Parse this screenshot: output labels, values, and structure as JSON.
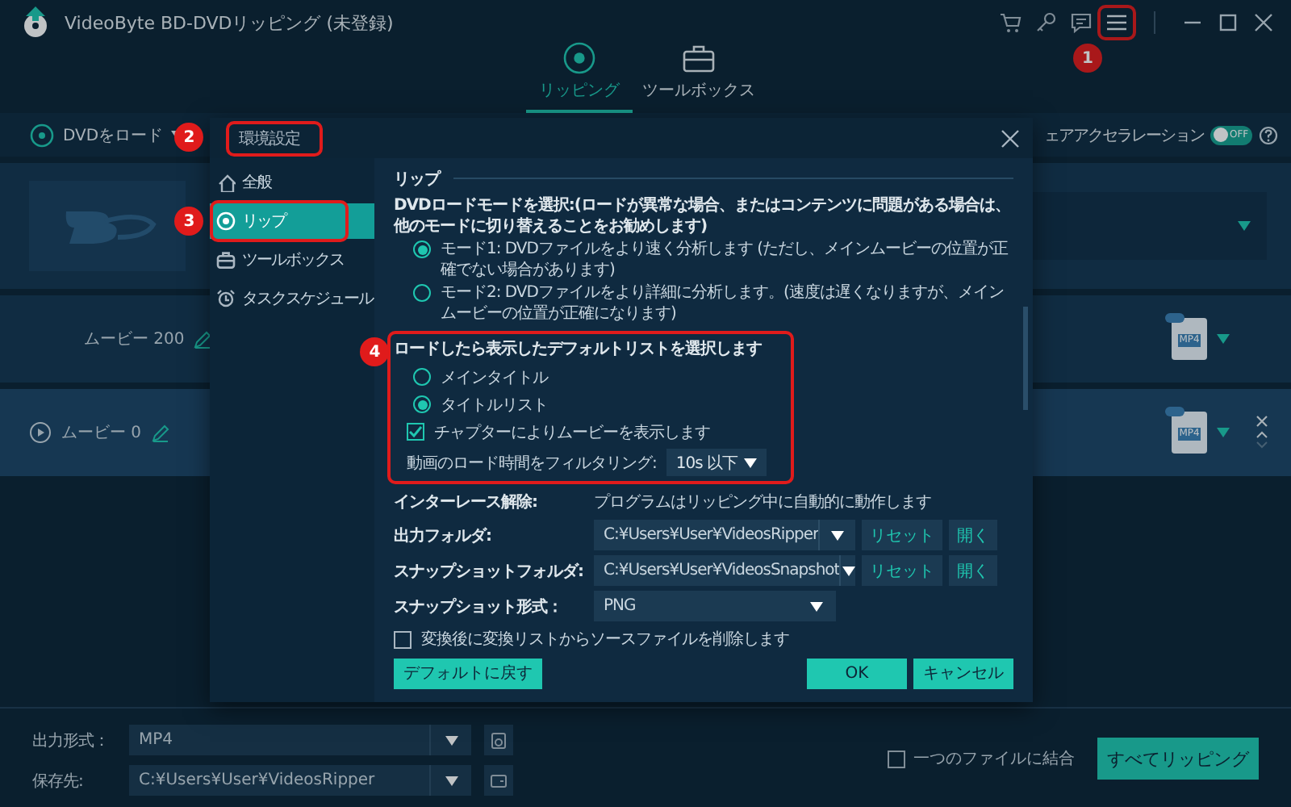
{
  "window": {
    "title": "VideoByte BD-DVDリッピング (未登録)"
  },
  "tabs": [
    {
      "label": "リッピング",
      "selected": true,
      "kind": "disc"
    },
    {
      "label": "ツールボックス",
      "selected": false,
      "kind": "toolbox"
    }
  ],
  "toolbar": {
    "load_button": "DVDをロード",
    "hardware_acceleration": {
      "label": "ェアアクセラレーション",
      "on": false,
      "switch_text": "OFF"
    }
  },
  "movies": [
    {
      "title": "ムービー 200",
      "format": "MP4",
      "selected": false
    },
    {
      "title": "ムービー 0",
      "format": "MP4",
      "selected": true
    }
  ],
  "dialog": {
    "title": "環境設定",
    "nav": [
      {
        "label": "全般",
        "selected": false,
        "kind": "home"
      },
      {
        "label": "リップ",
        "selected": true,
        "kind": "disc"
      },
      {
        "label": "ツールボックス",
        "selected": false,
        "kind": "toolbox"
      },
      {
        "label": "タスクスケジュール",
        "selected": false,
        "kind": "clock"
      }
    ],
    "section_title": "リップ",
    "load_mode": {
      "label": "DVDロードモードを選択:(ロードが異常な場合、またはコンテンツに問題がある場合は、他のモードに切り替えることをお勧めします)",
      "options": [
        {
          "label": "モード1: DVDファイルをより速く分析します (ただし、メインムービーの位置が正確でない場合があります)",
          "selected": true
        },
        {
          "label": "モード2: DVDファイルをより詳細に分析します。(速度は遅くなりますが、メインムービーの位置が正確になります)",
          "selected": false
        }
      ]
    },
    "default_list": {
      "label": "ロードしたら表示したデフォルトリストを選択します",
      "options": [
        {
          "label": "メインタイトル",
          "selected": false
        },
        {
          "label": "タイトルリスト",
          "selected": true
        }
      ],
      "chapter_checkbox": {
        "label": "チャプターによりムービーを表示します",
        "checked": true
      },
      "filter": {
        "label": "動画のロード時間をフィルタリング:",
        "value": "10s 以下"
      }
    },
    "deinterlace": {
      "label": "インターレース解除:",
      "value": "プログラムはリッピング中に自動的に動作します"
    },
    "folders": [
      {
        "label": "出力フォルダ:",
        "value": "C:¥Users¥User¥VideosRipper",
        "reset": "リセット",
        "open": "開く"
      },
      {
        "label": "スナップショットフォルダ:",
        "value": "C:¥Users¥User¥VideosSnapshot",
        "reset": "リセット",
        "open": "開く"
      }
    ],
    "snapshot_format": {
      "label": "スナップショット形式：",
      "value": "PNG"
    },
    "delete_source": {
      "label": "変換後に変換リストからソースファイルを削除します",
      "checked": false
    },
    "buttons": {
      "default": "デフォルトに戻す",
      "ok": "OK",
      "cancel": "キャンセル"
    }
  },
  "bottom": {
    "output_format": {
      "label": "出力形式：",
      "value": "MP4"
    },
    "save_to": {
      "label": "保存先:",
      "value": "C:¥Users¥User¥VideosRipper"
    },
    "merge": {
      "label": "一つのファイルに結合",
      "checked": false
    },
    "rip_all": "すべてリッピング"
  },
  "annotations": [
    {
      "label": "1",
      "kind": "menu"
    },
    {
      "label": "2",
      "kind": "dialog-title"
    },
    {
      "label": "3",
      "kind": "nav"
    },
    {
      "label": "4",
      "kind": "default-list"
    }
  ]
}
